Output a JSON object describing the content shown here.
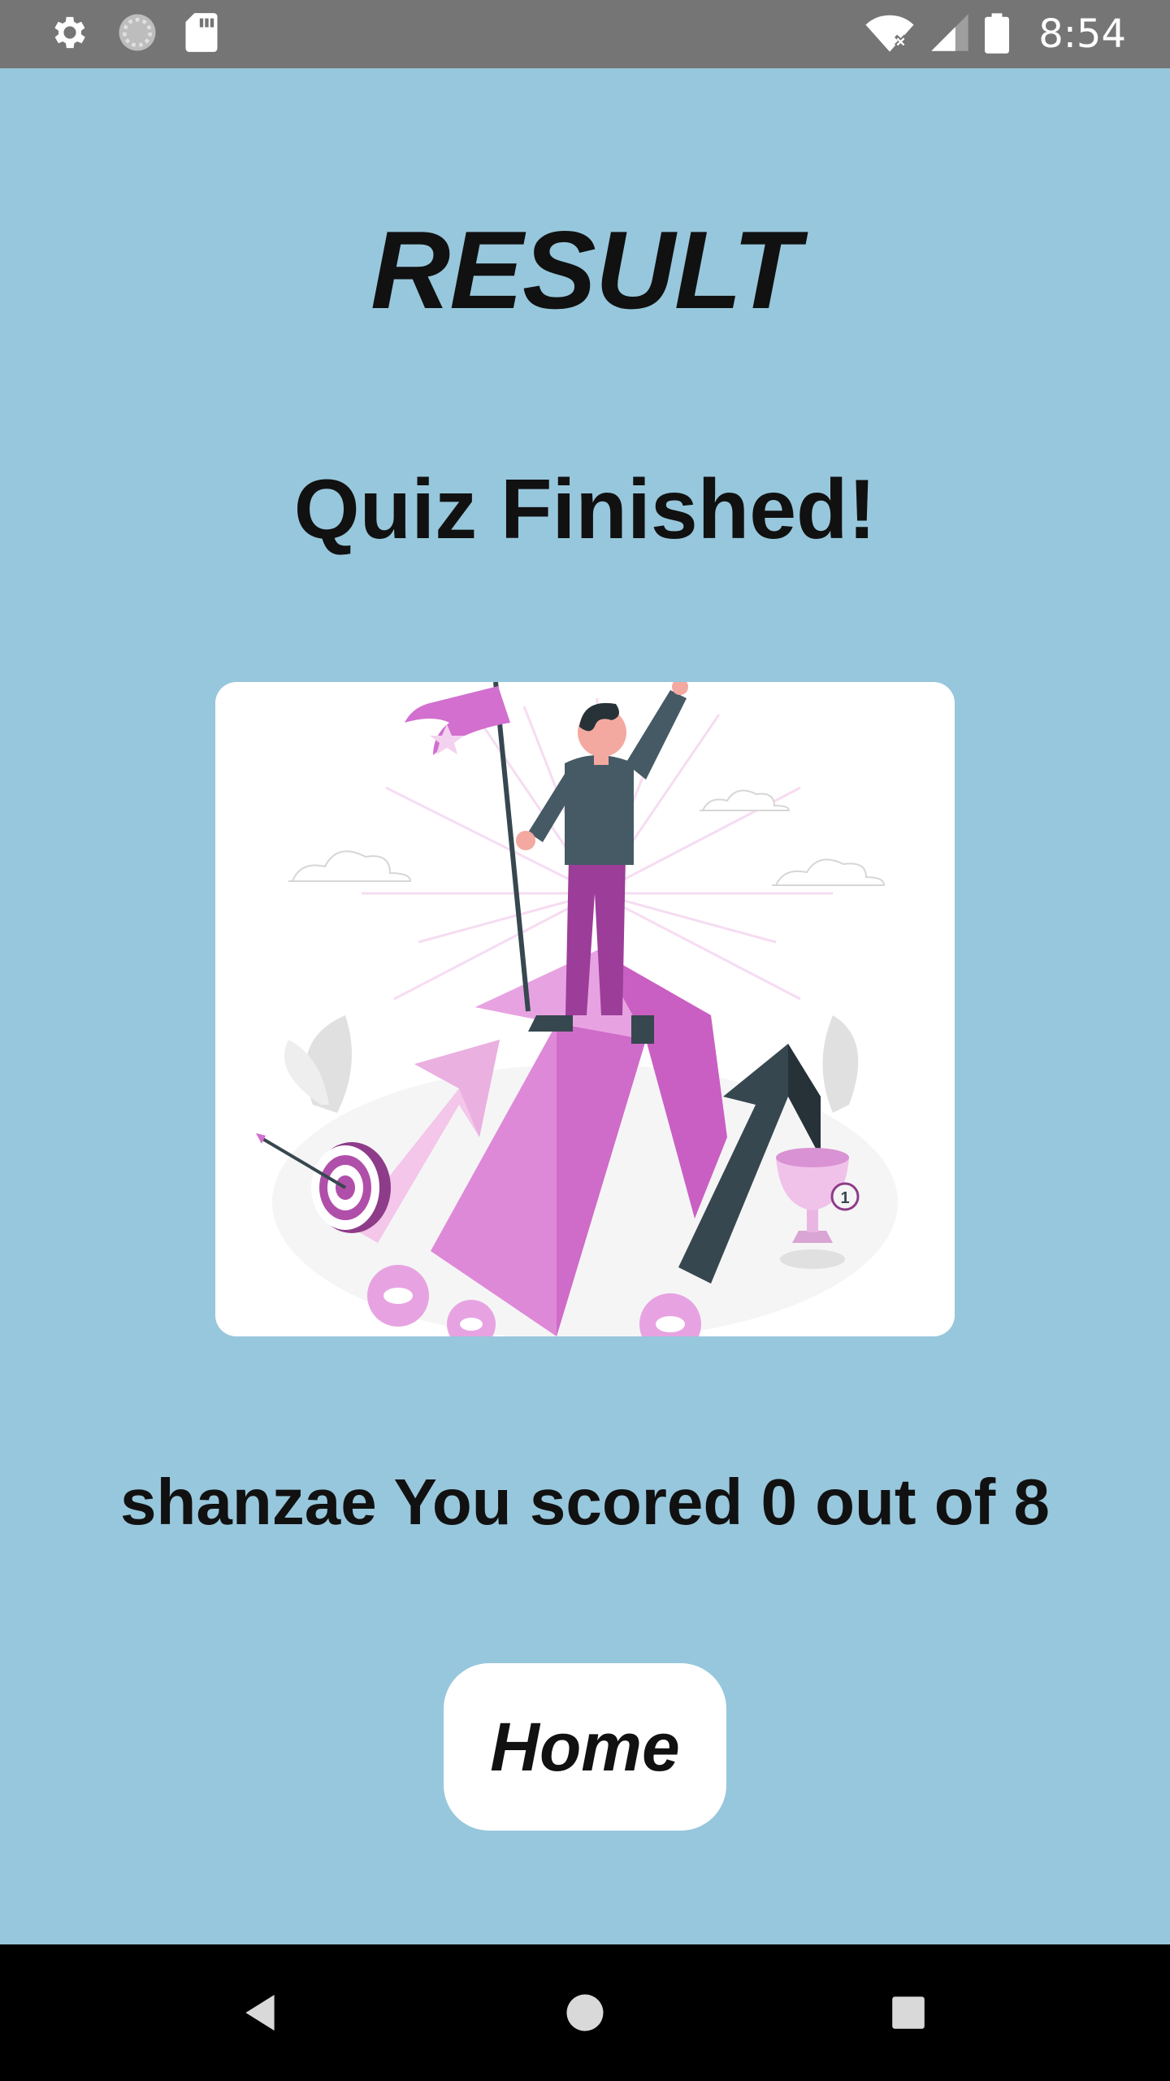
{
  "status_bar": {
    "time": "8:54",
    "left_icons": [
      "gear-icon",
      "sync-icon",
      "sd-card-icon"
    ],
    "right_icons": [
      "wifi-off-icon",
      "signal-icon",
      "battery-icon"
    ]
  },
  "main": {
    "title": "RESULT",
    "subtitle": "Quiz Finished!",
    "illustration": "success-illustration",
    "score_text": "shanzae You scored 0 out of 8",
    "home_button": "Home"
  },
  "score": {
    "user": "shanzae",
    "correct": 0,
    "total": 8
  },
  "nav_bar": {
    "buttons": [
      "back-icon",
      "home-icon",
      "recents-icon"
    ]
  },
  "colors": {
    "background": "#97c7dc",
    "status_bar": "#757575",
    "nav_bar": "#000000",
    "card": "#ffffff",
    "accent_pink": "#d26fcf",
    "accent_dark": "#37474f"
  }
}
